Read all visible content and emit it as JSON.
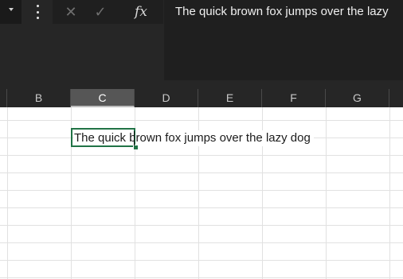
{
  "toolbar": {
    "namebox_dropdown_icon": "chevron-down-icon",
    "more_icon": "more-vertical-icon",
    "cancel_glyph": "✕",
    "enter_glyph": "✓",
    "fx_label": "fx"
  },
  "formula_bar": {
    "value": "The quick brown fox jumps over the lazy"
  },
  "columns": [
    {
      "id": "B",
      "label": "B",
      "selected": false
    },
    {
      "id": "C",
      "label": "C",
      "selected": true
    },
    {
      "id": "D",
      "label": "D",
      "selected": false
    },
    {
      "id": "E",
      "label": "E",
      "selected": false
    },
    {
      "id": "F",
      "label": "F",
      "selected": false
    },
    {
      "id": "G",
      "label": "G",
      "selected": false
    }
  ],
  "active_cell": {
    "column": "C",
    "value": "The quick brown fox jumps over the lazy dog"
  },
  "colors": {
    "selection_accent": "#217346",
    "header_background": "#262626",
    "selected_header_background": "#565656"
  }
}
